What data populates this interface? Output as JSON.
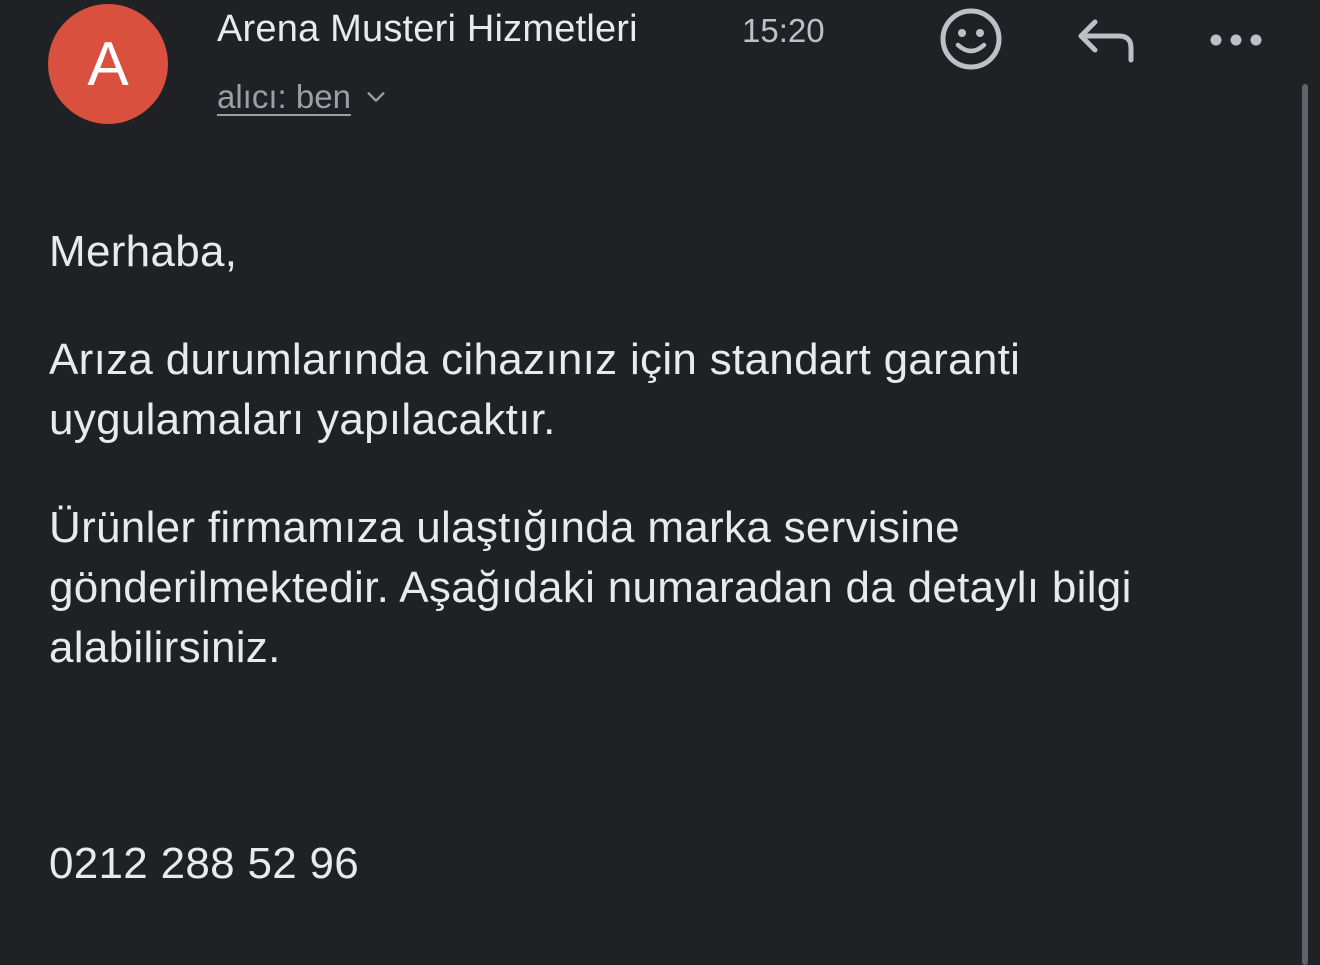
{
  "header": {
    "avatar_letter": "A",
    "avatar_color": "#d9503f",
    "sender_name": "Arena Musteri Hizmetleri",
    "time": "15:20",
    "recipient_label": "alıcı: ben"
  },
  "actions": {
    "emoji_icon": "smiley-face-icon",
    "reply_icon": "reply-arrow-icon",
    "more_icon": "more-horizontal-icon"
  },
  "message": {
    "greeting": "Merhaba,",
    "paragraph1": "Arıza durumlarında cihazınız için standart garanti uygulamaları yapılacaktır.",
    "paragraph2": "Ürünler firmamıza ulaştığında marka servisine gönderilmektedir. Aşağıdaki numaradan da detaylı bilgi alabilirsiniz.",
    "phone": "0212 288 52 96"
  },
  "theme": {
    "background": "#202124",
    "text": "#e8eaed",
    "muted": "#9aa0a6"
  }
}
